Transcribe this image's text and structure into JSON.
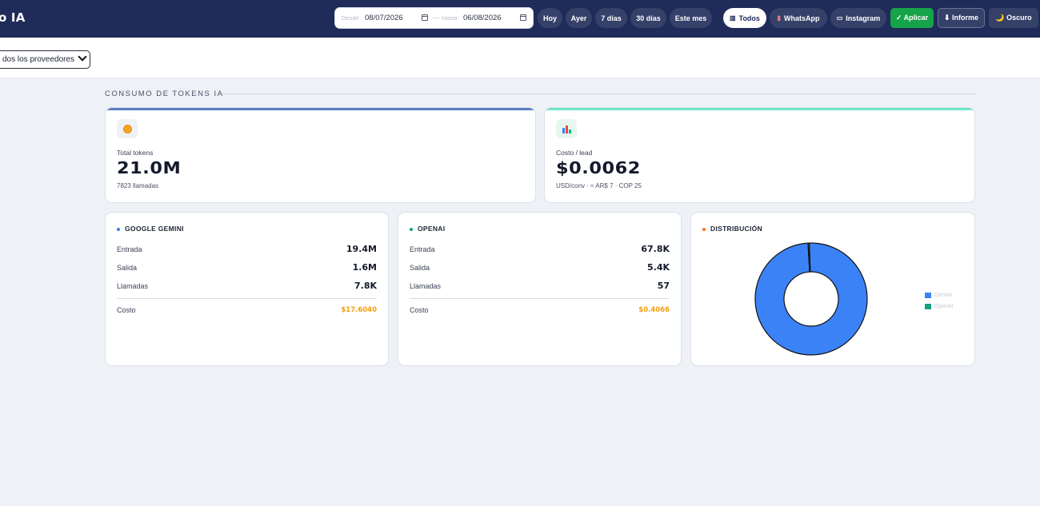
{
  "app": {
    "title": "o IA"
  },
  "filters": {
    "from_label": "Desde",
    "from_value": "08/07/2026",
    "to_label": "Hasta",
    "to_value": "06/08/2026",
    "range_separator": "—",
    "presets": [
      "Hoy",
      "Ayer",
      "7 días",
      "30 días",
      "Este mes"
    ],
    "channels": [
      {
        "label": "Todos",
        "icon": "chart-icon",
        "active": true
      },
      {
        "label": "WhatsApp",
        "icon": "whatsapp-icon",
        "active": false
      },
      {
        "label": "Instagram",
        "icon": "instagram-icon",
        "active": false
      }
    ],
    "apply_label": "✓ Aplicar",
    "report_label": "⬇ Informe",
    "theme_label": "🌙 Oscuro"
  },
  "provider_select": {
    "value": "dos los proveedores"
  },
  "section": {
    "title": "CONSUMO DE TOKENS IA"
  },
  "kpis": [
    {
      "label": "Total tokens",
      "value": "21.0M",
      "sub": "7823 llamadas",
      "icon": "coin-icon",
      "accent": "#5b7fbf"
    },
    {
      "label": "Costo / lead",
      "value": "$0.0062",
      "sub": "USD/conv · ≈ AR$ 7 · COP 25",
      "icon": "bar-chart-icon",
      "accent": "#6ee7c5"
    }
  ],
  "providers": [
    {
      "title": "GOOGLE GEMINI",
      "dot_color": "#3b82f6",
      "rows": [
        {
          "label": "Entrada",
          "value": "19.4M"
        },
        {
          "label": "Salida",
          "value": "1.6M"
        },
        {
          "label": "Llamadas",
          "value": "7.8K"
        }
      ],
      "cost_label": "Costo",
      "cost_value": "$17.6040"
    },
    {
      "title": "OPENAI",
      "dot_color": "#10a37f",
      "rows": [
        {
          "label": "Entrada",
          "value": "67.8K"
        },
        {
          "label": "Salida",
          "value": "5.4K"
        },
        {
          "label": "Llamadas",
          "value": "57"
        }
      ],
      "cost_label": "Costo",
      "cost_value": "$0.4066"
    }
  ],
  "distribution": {
    "title": "DISTRIBUCIÓN",
    "dot_color": "#f97316"
  },
  "chart_data": {
    "type": "pie",
    "donut": true,
    "categories": [
      "Gemini",
      "OpenAI"
    ],
    "values": [
      21.0,
      0.0733
    ],
    "colors": [
      "#3b82f6",
      "#10a37f"
    ],
    "legend": "right"
  }
}
